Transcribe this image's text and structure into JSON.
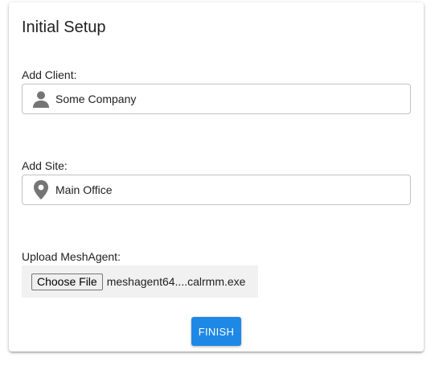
{
  "card": {
    "title": "Initial Setup"
  },
  "client": {
    "label": "Add Client:",
    "value": "Some Company",
    "icon": "person-icon"
  },
  "site": {
    "label": "Add Site:",
    "value": "Main Office",
    "icon": "location-pin-icon"
  },
  "upload": {
    "label": "Upload MeshAgent:",
    "button_label": "Choose File",
    "file_name": "meshagent64....calrmm.exe"
  },
  "actions": {
    "finish_label": "FINISH"
  },
  "colors": {
    "accent": "#1e88e5",
    "icon": "#757575"
  }
}
